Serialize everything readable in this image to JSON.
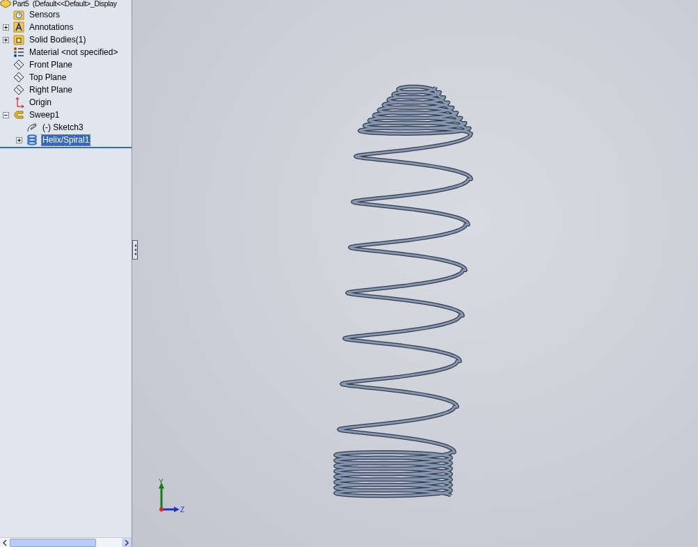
{
  "feature_tree": {
    "root": {
      "label": "Part5  (Default<<Default>_Display"
    },
    "items": [
      {
        "kind": "sensors",
        "label": "Sensors",
        "selected": false
      },
      {
        "kind": "annotations",
        "label": "Annotations",
        "expanded": false,
        "selected": false
      },
      {
        "kind": "bodies",
        "label": "Solid Bodies(1)",
        "expanded": false,
        "selected": false
      },
      {
        "kind": "material",
        "label": "Material <not specified>",
        "selected": false
      },
      {
        "kind": "plane",
        "label": "Front Plane",
        "selected": false
      },
      {
        "kind": "plane",
        "label": "Top Plane",
        "selected": false
      },
      {
        "kind": "plane",
        "label": "Right Plane",
        "selected": false
      },
      {
        "kind": "origin",
        "label": "Origin",
        "selected": false
      },
      {
        "kind": "sweep",
        "label": "Sweep1",
        "expanded": true,
        "selected": false,
        "children": [
          {
            "kind": "sketch",
            "label": "(-) Sketch3",
            "selected": false
          },
          {
            "kind": "helix",
            "label": "Helix/Spiral1",
            "expanded": false,
            "selected": true
          }
        ]
      }
    ]
  },
  "triad": {
    "y_label": "Y",
    "z_label": "Z"
  }
}
